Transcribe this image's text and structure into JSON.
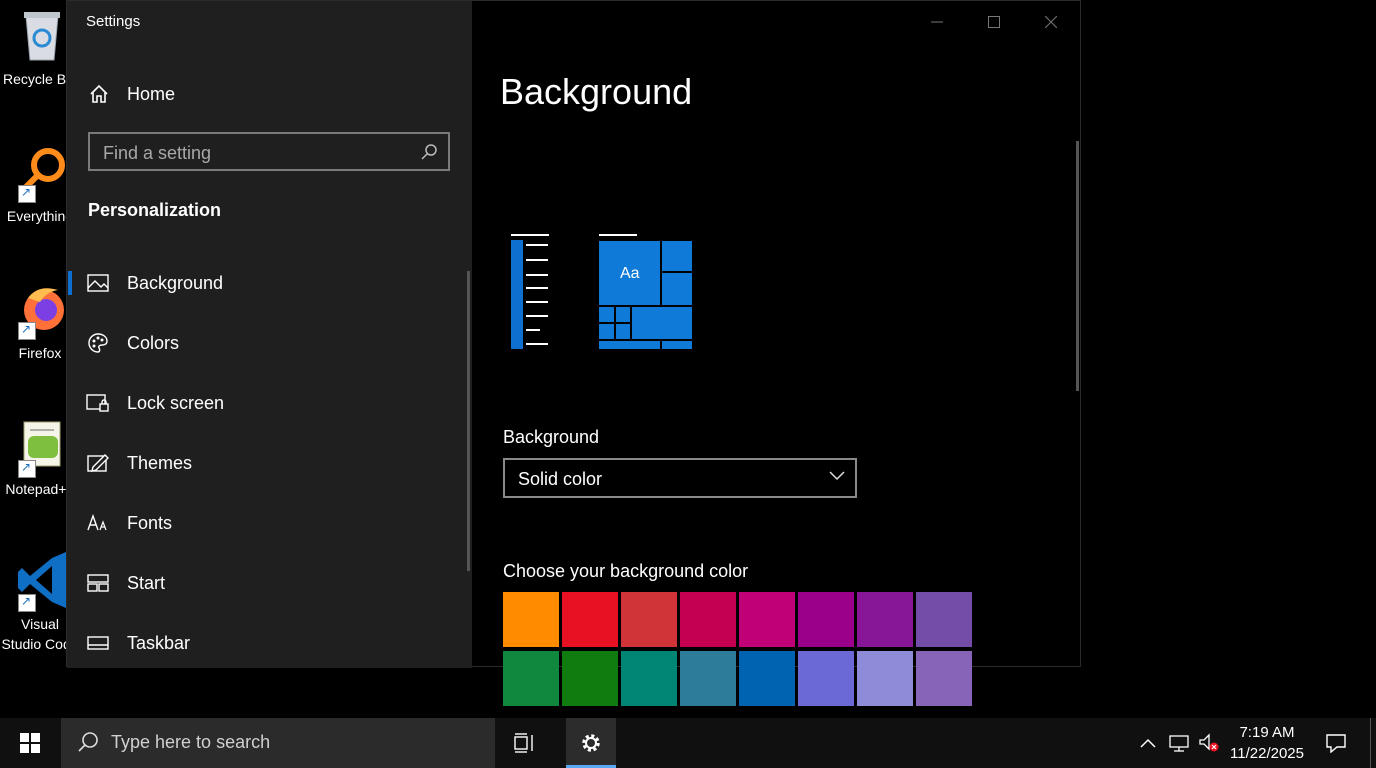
{
  "desktop": {
    "icons": [
      {
        "label": "Recycle Bin"
      },
      {
        "label": "Everything"
      },
      {
        "label": "Firefox"
      },
      {
        "label": "Notepad++"
      },
      {
        "label": "Visual Studio Code"
      }
    ]
  },
  "window": {
    "title": "Settings",
    "nav": {
      "home": "Home",
      "search_placeholder": "Find a setting",
      "section": "Personalization",
      "items": [
        {
          "label": "Background",
          "icon": "picture-icon",
          "active": true
        },
        {
          "label": "Colors",
          "icon": "palette-icon"
        },
        {
          "label": "Lock screen",
          "icon": "lock-screen-icon"
        },
        {
          "label": "Themes",
          "icon": "themes-icon"
        },
        {
          "label": "Fonts",
          "icon": "fonts-icon"
        },
        {
          "label": "Start",
          "icon": "start-icon"
        },
        {
          "label": "Taskbar",
          "icon": "taskbar-icon"
        }
      ]
    },
    "content": {
      "title": "Background",
      "preview_text": "Aa",
      "background_label": "Background",
      "background_value": "Solid color",
      "choose_color_label": "Choose your background color",
      "swatches": [
        "#ff8c00",
        "#e81123",
        "#d13438",
        "#c30052",
        "#bf0077",
        "#9a0089",
        "#881798",
        "#744da9",
        "#10893e",
        "#107c10",
        "#018574",
        "#2d7d9a",
        "#0063b1",
        "#6b69d6",
        "#8e8cd8",
        "#8764b8"
      ]
    }
  },
  "taskbar": {
    "search_placeholder": "Type here to search",
    "time": "7:19 AM",
    "date": "11/22/2025"
  },
  "colors": {
    "accent": "#0078d7",
    "nav_bg": "#1f1f1f",
    "content_bg": "#000000"
  }
}
